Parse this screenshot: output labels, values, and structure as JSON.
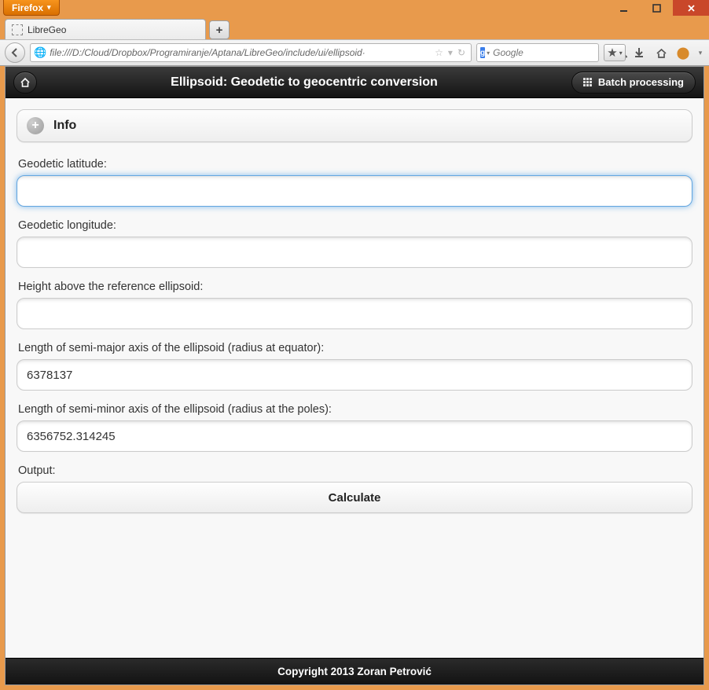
{
  "browser": {
    "menu_label": "Firefox",
    "tab_title": "LibreGeo",
    "url": "file:///D:/Cloud/Dropbox/Programiranje/Aptana/LibreGeo/include/ui/ellipsoid·",
    "search_provider_letter": "g",
    "search_placeholder": "Google"
  },
  "header": {
    "title": "Ellipsoid: Geodetic to geocentric conversion",
    "batch_label": "Batch processing"
  },
  "info": {
    "label": "Info"
  },
  "form": {
    "lat": {
      "label": "Geodetic latitude:",
      "value": ""
    },
    "lon": {
      "label": "Geodetic longitude:",
      "value": ""
    },
    "height": {
      "label": "Height above the reference ellipsoid:",
      "value": ""
    },
    "a": {
      "label": "Length of semi-major axis of the ellipsoid (radius at equator):",
      "value": "6378137"
    },
    "b": {
      "label": "Length of semi-minor axis of the ellipsoid (radius at the poles):",
      "value": "6356752.314245"
    },
    "output": {
      "label": "Output:"
    },
    "calculate_label": "Calculate"
  },
  "footer": {
    "copyright": "Copyright 2013 Zoran Petrović"
  }
}
